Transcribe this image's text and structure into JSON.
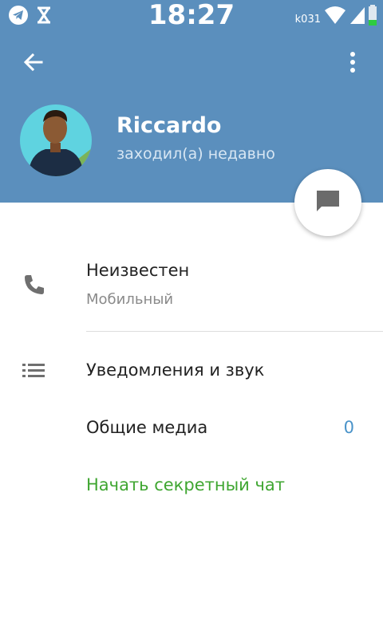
{
  "status_bar": {
    "time": "18:27",
    "carrier": "k031"
  },
  "toolbar": {
    "back_icon": "arrow-left-icon",
    "menu_icon": "more-vertical-icon"
  },
  "profile": {
    "name": "Riccardo",
    "status": "заходил(а) недавно"
  },
  "fab": {
    "icon": "message-icon"
  },
  "info": {
    "phone": "Неизвестен",
    "phone_type": "Мобильный",
    "notifications": "Уведомления и звук",
    "shared_media": "Общие медиа",
    "shared_media_count": "0",
    "secret_chat": "Начать секретный чат"
  },
  "colors": {
    "header_bg": "#5b8fbd",
    "accent_blue": "#4a93c9",
    "secret_green": "#3fa631"
  }
}
